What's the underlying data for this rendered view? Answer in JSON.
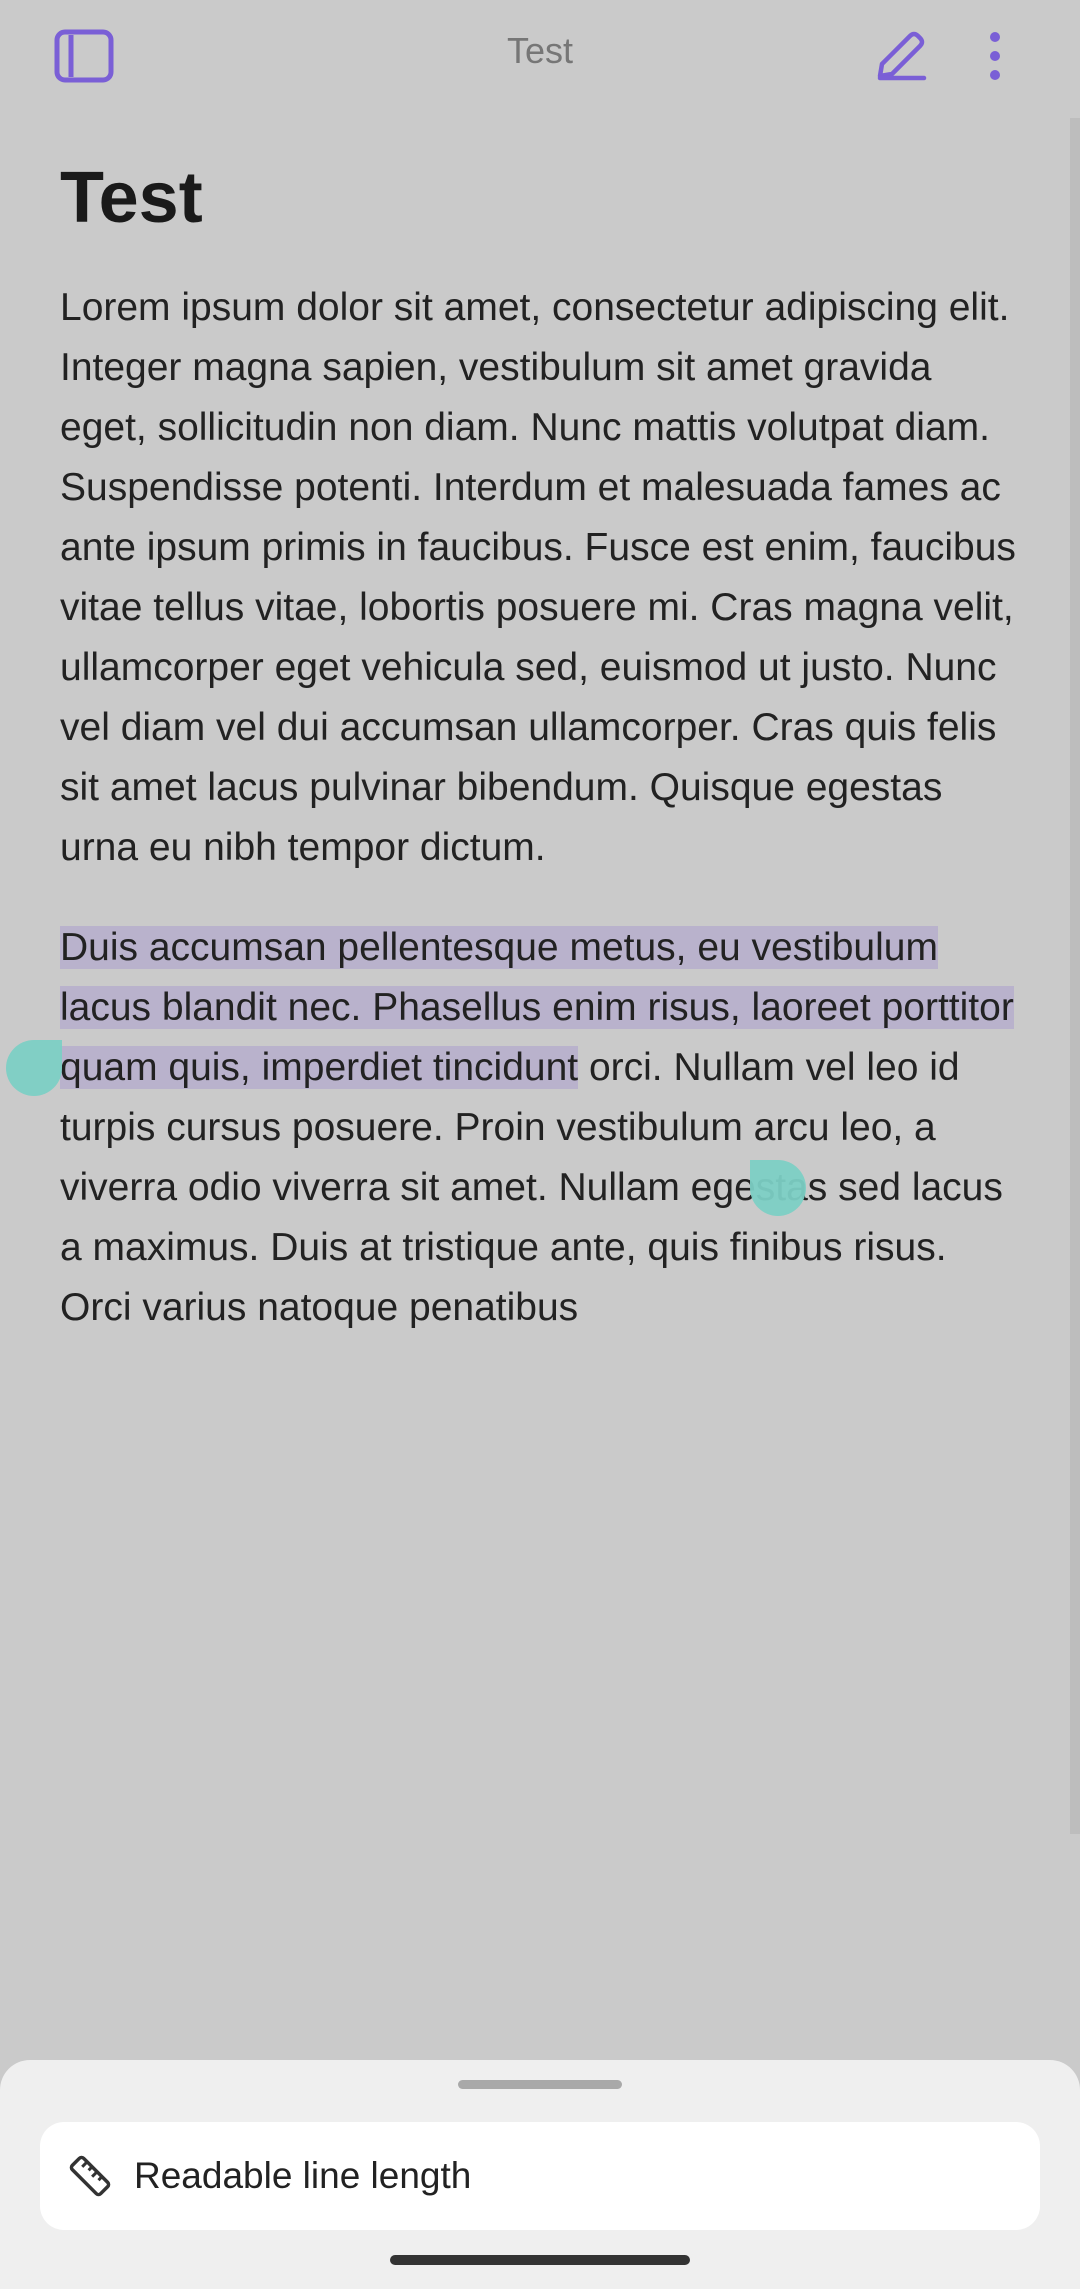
{
  "topbar": {
    "title": "Test",
    "icons": {
      "sidebar": "sidebar-toggle-icon",
      "edit": "pencil-icon",
      "more": "more-vertical-icon"
    },
    "accent": "#7a5fd6"
  },
  "note": {
    "title": "Test",
    "paragraph1": "Lorem ipsum dolor sit amet, consectetur adipiscing elit. Integer magna sapien, vestibulum sit amet gravida eget, sollicitudin non diam. Nunc mattis volutpat diam. Suspendisse potenti. Interdum et malesuada fames ac ante ipsum primis in faucibus. Fusce est enim, faucibus vitae tellus vitae, lobortis posuere mi. Cras magna velit, ullamcorper eget vehicula sed, euismod ut justo. Nunc vel diam vel dui accumsan ullamcorper. Cras quis felis sit amet lacus pulvinar bibendum. Quisque egestas urna eu nibh tempor dictum.",
    "paragraph2_selected": "Duis accumsan pellentesque metus, eu vestibulum lacus blandit nec. Phasellus enim risus, laoreet porttitor quam quis, imperdiet tincidunt",
    "paragraph2_rest": " orci. Nullam vel leo id turpis cursus posuere. Proin vestibulum arcu leo, a viverra odio viverra sit amet. Nullam egestas sed lacus a maximus. Duis at tristique ante, quis finibus risus. Orci varius natoque penatibus",
    "selection_color": "#b9b2cc",
    "handle_color": "#7ccfc4"
  },
  "bottom_sheet": {
    "item_label": "Readable line length",
    "item_icon": "ruler-icon"
  }
}
